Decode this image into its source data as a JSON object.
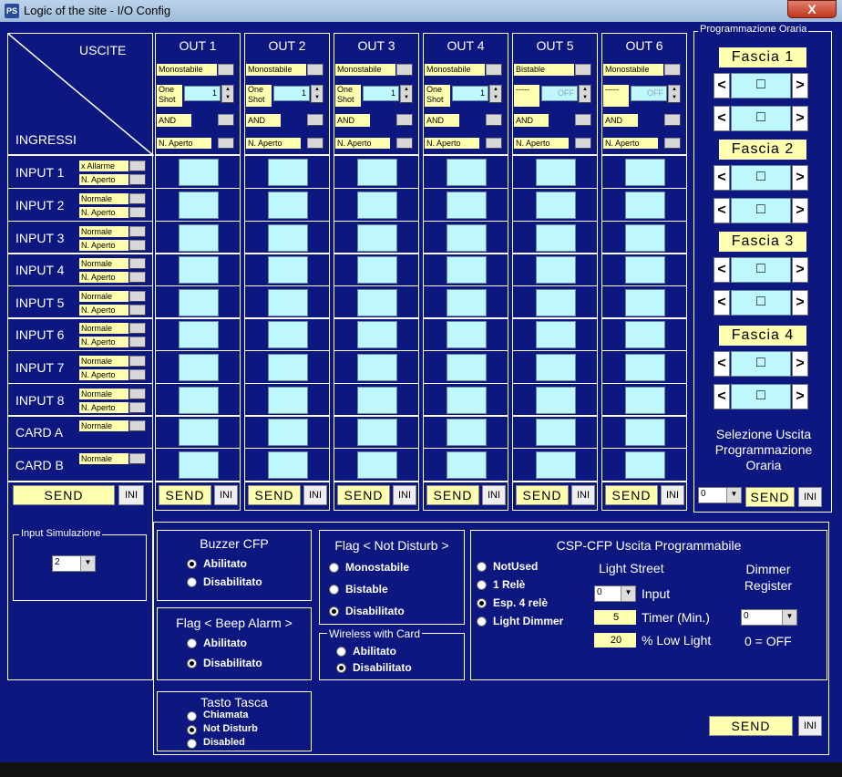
{
  "window": {
    "title": "Logic of the site - I/O Config",
    "close": "X",
    "app_icon": "PS"
  },
  "matrix": {
    "uscite": "USCITE",
    "ingressi": "INGRESSI",
    "outputs": [
      {
        "label": "OUT 1",
        "mode": "Monostabile",
        "shot_line1": "One",
        "shot_line2": "Shot",
        "value": "1",
        "logic": "AND",
        "contact": "N. Aperto"
      },
      {
        "label": "OUT 2",
        "mode": "Monostabile",
        "shot_line1": "One",
        "shot_line2": "Shot",
        "value": "1",
        "logic": "AND",
        "contact": "N. Aperto"
      },
      {
        "label": "OUT 3",
        "mode": "Monostabile",
        "shot_line1": "One",
        "shot_line2": "Shot",
        "value": "1",
        "logic": "AND",
        "contact": "N. Aperto"
      },
      {
        "label": "OUT 4",
        "mode": "Monostabile",
        "shot_line1": "One",
        "shot_line2": "Shot",
        "value": "1",
        "logic": "AND",
        "contact": "N. Aperto"
      },
      {
        "label": "OUT 5",
        "mode": "Bistable",
        "shot_line1": "-----",
        "shot_line2": "",
        "value": "OFF",
        "logic": "AND",
        "contact": "N. Aperto"
      },
      {
        "label": "OUT 6",
        "mode": "Monostabile",
        "shot_line1": "-----",
        "shot_line2": "",
        "value": "OFF",
        "logic": "AND",
        "contact": "N. Aperto"
      }
    ],
    "inputs": [
      {
        "label": "INPUT 1",
        "type": "x Allarme",
        "contact": "N. Aperto"
      },
      {
        "label": "INPUT 2",
        "type": "Normale",
        "contact": "N. Aperto"
      },
      {
        "label": "INPUT 3",
        "type": "Normale",
        "contact": "N. Aperto"
      },
      {
        "label": "INPUT 4",
        "type": "Normale",
        "contact": "N. Aperto"
      },
      {
        "label": "INPUT 5",
        "type": "Normale",
        "contact": "N. Aperto"
      },
      {
        "label": "INPUT 6",
        "type": "Normale",
        "contact": "N. Aperto"
      },
      {
        "label": "INPUT 7",
        "type": "Normale",
        "contact": "N. Aperto"
      },
      {
        "label": "INPUT 8",
        "type": "Normale",
        "contact": "N. Aperto"
      },
      {
        "label": "CARD A",
        "type": "Normale",
        "contact": ""
      },
      {
        "label": "CARD B",
        "type": "Normale",
        "contact": ""
      }
    ],
    "send_label": "SEND",
    "ini_label": "INI"
  },
  "schedule": {
    "title": "Programmazione Oraria",
    "bands": [
      "Fascia  1",
      "Fascia  2",
      "Fascia  3",
      "Fascia  4"
    ],
    "left_arrow": "<",
    "right_arrow": ">",
    "slot_glyph": "□",
    "selection_label": "Selezione Uscita Programmazione Oraria",
    "selection_value": "0",
    "send_label": "SEND",
    "ini_label": "INI"
  },
  "simulation": {
    "title": "Input Simulazione",
    "value": "2"
  },
  "buzzer": {
    "title": "Buzzer CFP",
    "options": [
      "Abilitato",
      "Disabilitato"
    ],
    "selected": 0
  },
  "beep": {
    "title": "Flag < Beep Alarm >",
    "options": [
      "Abilitato",
      "Disabilitato"
    ],
    "selected": 1
  },
  "notdisturb": {
    "title": "Flag < Not Disturb >",
    "options": [
      "Monostabile",
      "Bistable",
      "Disabilitato"
    ],
    "selected": 2
  },
  "wireless": {
    "title": "Wireless with Card",
    "options": [
      "Abilitato",
      "Disabilitato"
    ],
    "selected": 1
  },
  "tasca": {
    "title": "Tasto Tasca",
    "options": [
      "Chiamata",
      "Not Disturb",
      "Disabled"
    ],
    "selected": 1
  },
  "csp": {
    "title": "CSP-CFP Uscita Programmabile",
    "options": [
      "NotUsed",
      "1 Relè",
      "Esp. 4 relè",
      "Light Dimmer"
    ],
    "selected": 2,
    "light_street": "Light Street",
    "input_value": "0",
    "input_label": "Input",
    "timer_value": "5",
    "timer_label": "Timer (Min.)",
    "low_value": "20",
    "low_label": "% Low Light",
    "dimmer_title": "Dimmer Register",
    "dimmer_value": "0",
    "dimmer_note": "0 = OFF"
  },
  "footer": {
    "send_label": "SEND",
    "ini_label": "INI"
  }
}
